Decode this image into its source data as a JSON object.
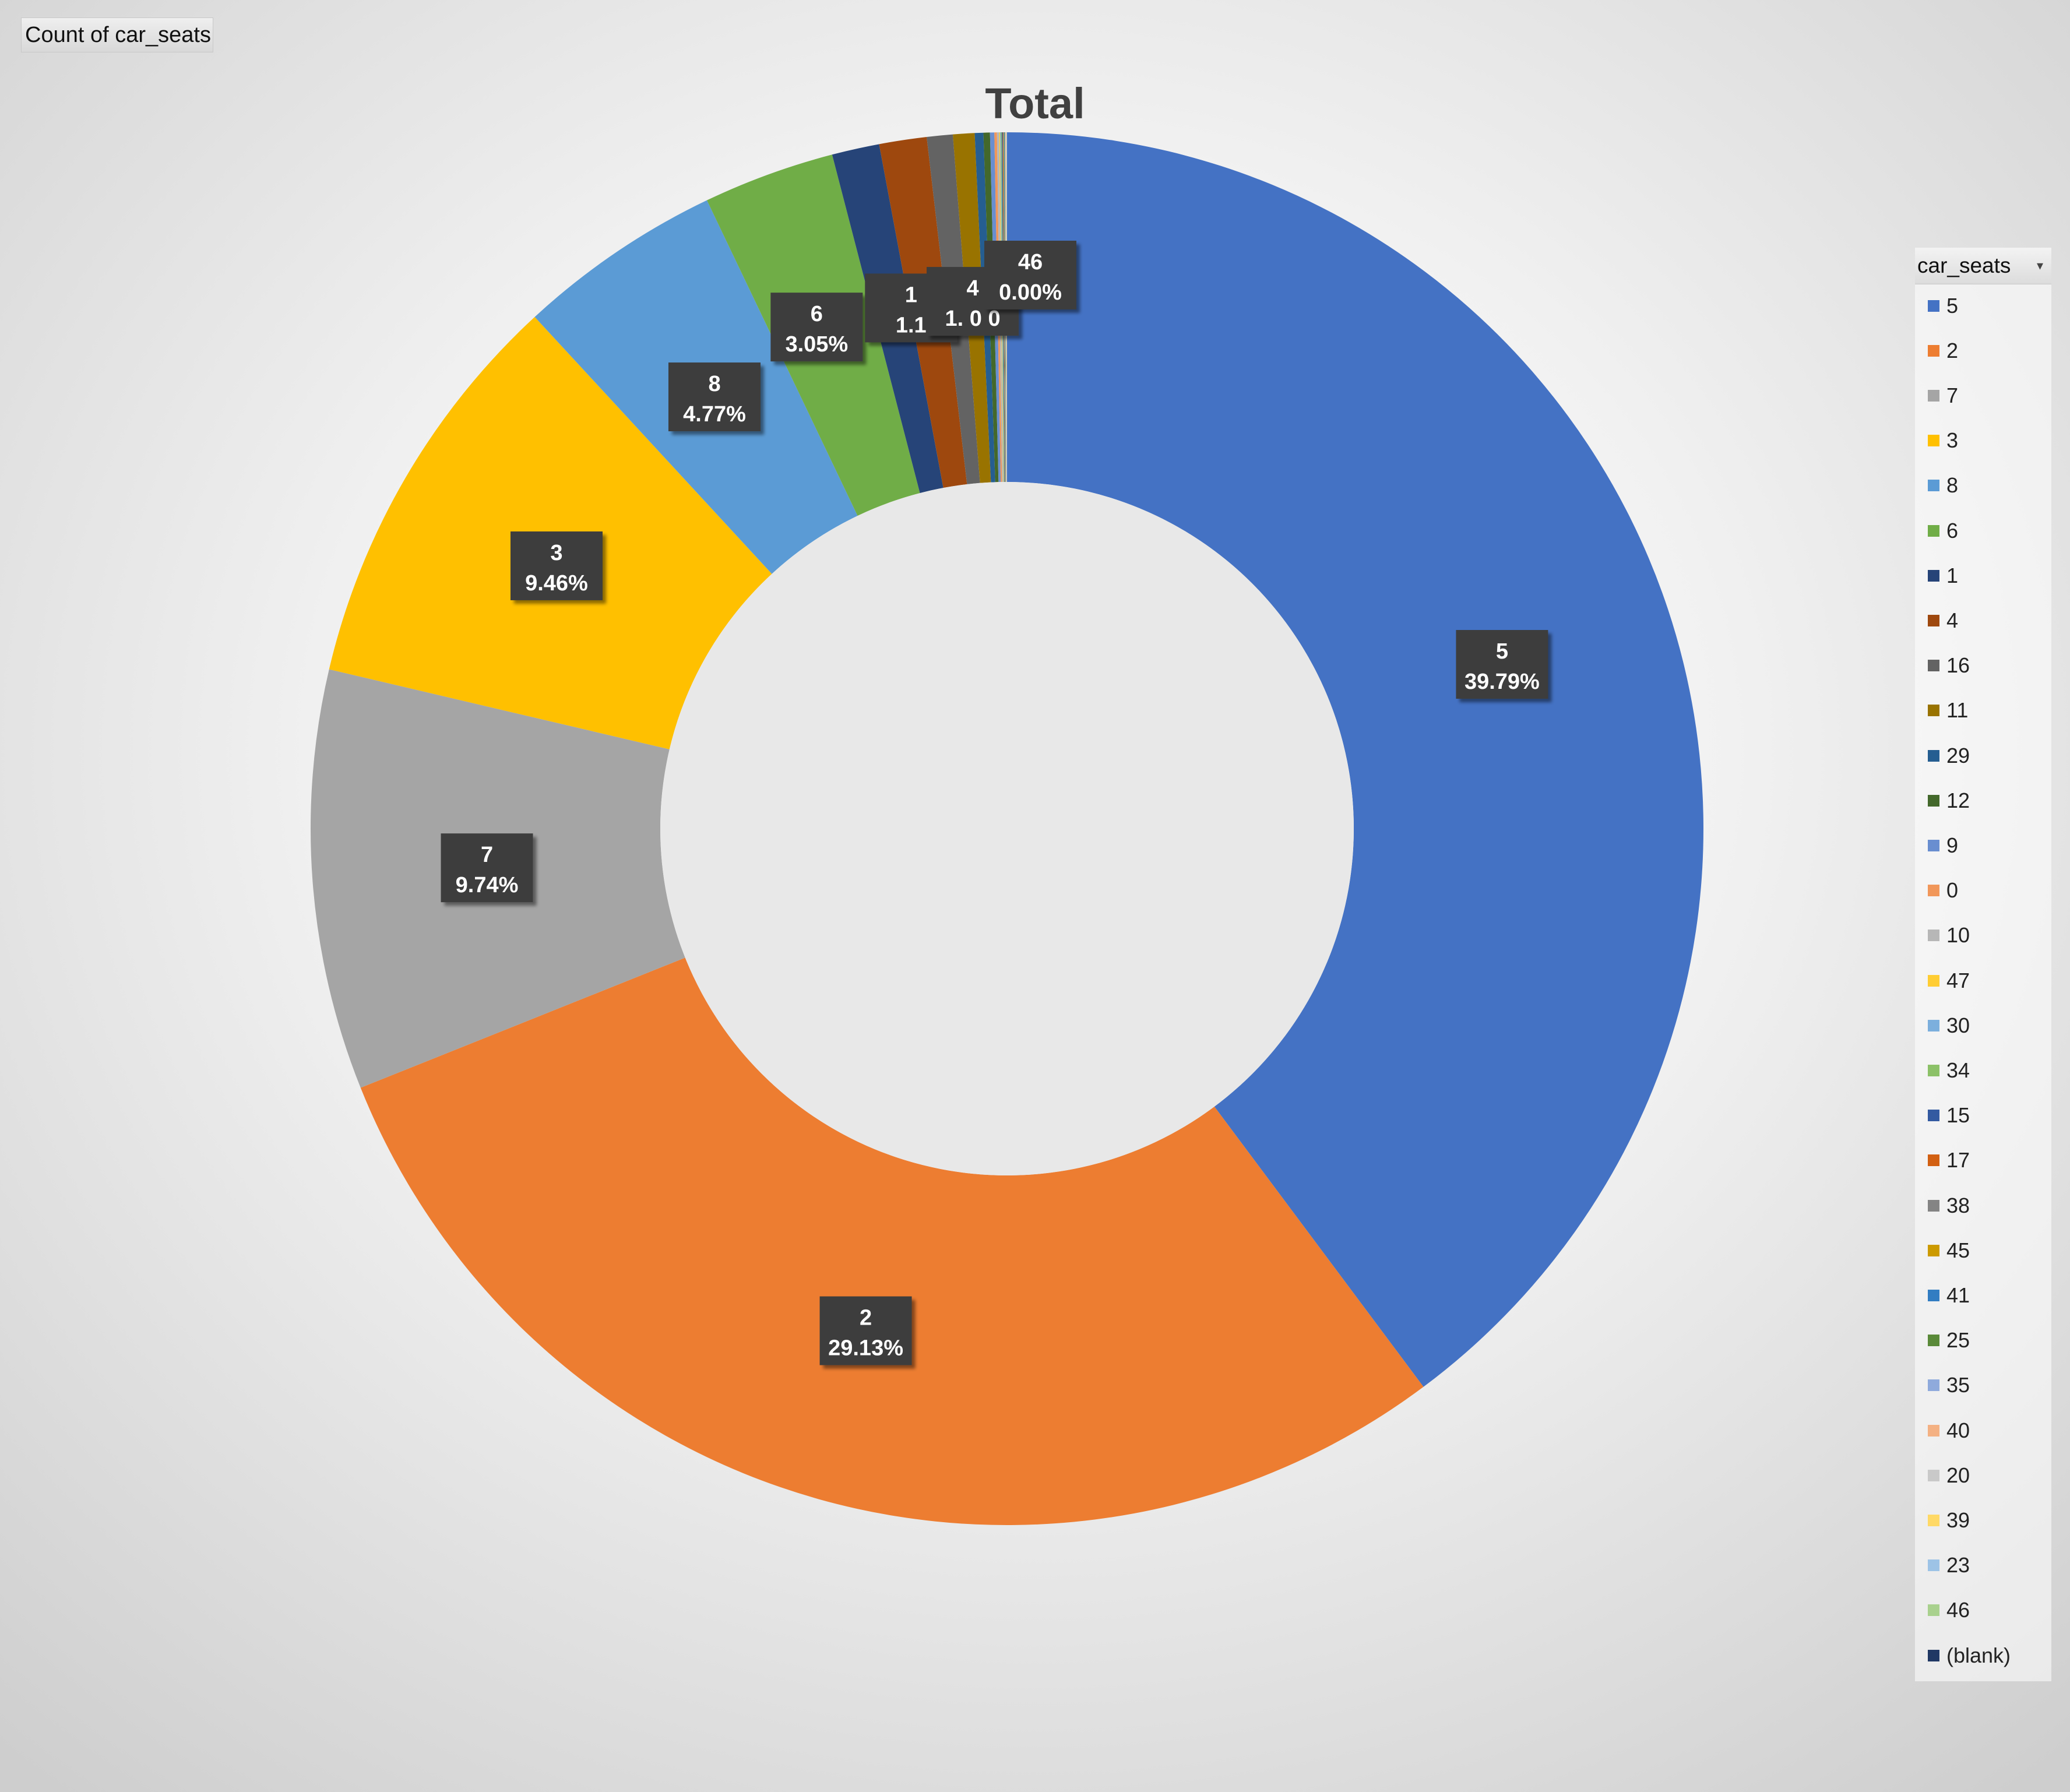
{
  "field_button": {
    "label": "Count of car_seats"
  },
  "legend": {
    "title": "car_seats",
    "items": [
      {
        "label": "5",
        "color": "#4472c4"
      },
      {
        "label": "2",
        "color": "#ed7d31"
      },
      {
        "label": "7",
        "color": "#a5a5a5"
      },
      {
        "label": "3",
        "color": "#ffc000"
      },
      {
        "label": "8",
        "color": "#5b9bd5"
      },
      {
        "label": "6",
        "color": "#70ad47"
      },
      {
        "label": "1",
        "color": "#264478"
      },
      {
        "label": "4",
        "color": "#9e480e"
      },
      {
        "label": "16",
        "color": "#636363"
      },
      {
        "label": "11",
        "color": "#997300"
      },
      {
        "label": "29",
        "color": "#255e91"
      },
      {
        "label": "12",
        "color": "#43682b"
      },
      {
        "label": "9",
        "color": "#698ed0"
      },
      {
        "label": "0",
        "color": "#f1975a"
      },
      {
        "label": "10",
        "color": "#b7b7b7"
      },
      {
        "label": "47",
        "color": "#ffcd33"
      },
      {
        "label": "30",
        "color": "#7cafdd"
      },
      {
        "label": "34",
        "color": "#8cc168"
      },
      {
        "label": "15",
        "color": "#335aa1"
      },
      {
        "label": "17",
        "color": "#d26012"
      },
      {
        "label": "38",
        "color": "#848484"
      },
      {
        "label": "45",
        "color": "#cc9a00"
      },
      {
        "label": "41",
        "color": "#327dc2"
      },
      {
        "label": "25",
        "color": "#5a8a39"
      },
      {
        "label": "35",
        "color": "#8faadc"
      },
      {
        "label": "40",
        "color": "#f4b183"
      },
      {
        "label": "20",
        "color": "#c9c9c9"
      },
      {
        "label": "39",
        "color": "#ffd966"
      },
      {
        "label": "23",
        "color": "#9dc3e6"
      },
      {
        "label": "46",
        "color": "#a9d18e"
      },
      {
        "label": "(blank)",
        "color": "#203864"
      }
    ]
  },
  "chart_data": {
    "type": "pie",
    "style": "doughnut",
    "title": "Total",
    "series_label": "Count of car_seats",
    "categories": [
      "5",
      "2",
      "7",
      "3",
      "8",
      "6",
      "1",
      "4",
      "16",
      "11",
      "29",
      "12",
      "9",
      "0",
      "10",
      "47",
      "30",
      "34",
      "15",
      "17",
      "38",
      "45",
      "41",
      "25",
      "35",
      "40",
      "20",
      "39",
      "23",
      "46",
      "(blank)"
    ],
    "values": [
      39.79,
      29.13,
      9.74,
      9.46,
      4.77,
      3.05,
      1.1,
      1.1,
      0.6,
      0.5,
      0.2,
      0.15,
      0.1,
      0.06,
      0.05,
      0.02,
      0.02,
      0.02,
      0.02,
      0.01,
      0.01,
      0.01,
      0.01,
      0.01,
      0.01,
      0.01,
      0.01,
      0.01,
      0.01,
      0.0,
      0.0
    ],
    "value_unit": "%",
    "data_labels": [
      {
        "category": "5",
        "text": "39.79%"
      },
      {
        "category": "2",
        "text": "29.13%"
      },
      {
        "category": "7",
        "text": "9.74%"
      },
      {
        "category": "3",
        "text": "9.46%"
      },
      {
        "category": "8",
        "text": "4.77%"
      },
      {
        "category": "6",
        "text": "3.05%"
      },
      {
        "category": "1",
        "text": "1.1"
      },
      {
        "category": "4",
        "text": "1. 0 0"
      },
      {
        "category": "46",
        "text": "0.00%"
      }
    ],
    "legend_position": "right"
  }
}
